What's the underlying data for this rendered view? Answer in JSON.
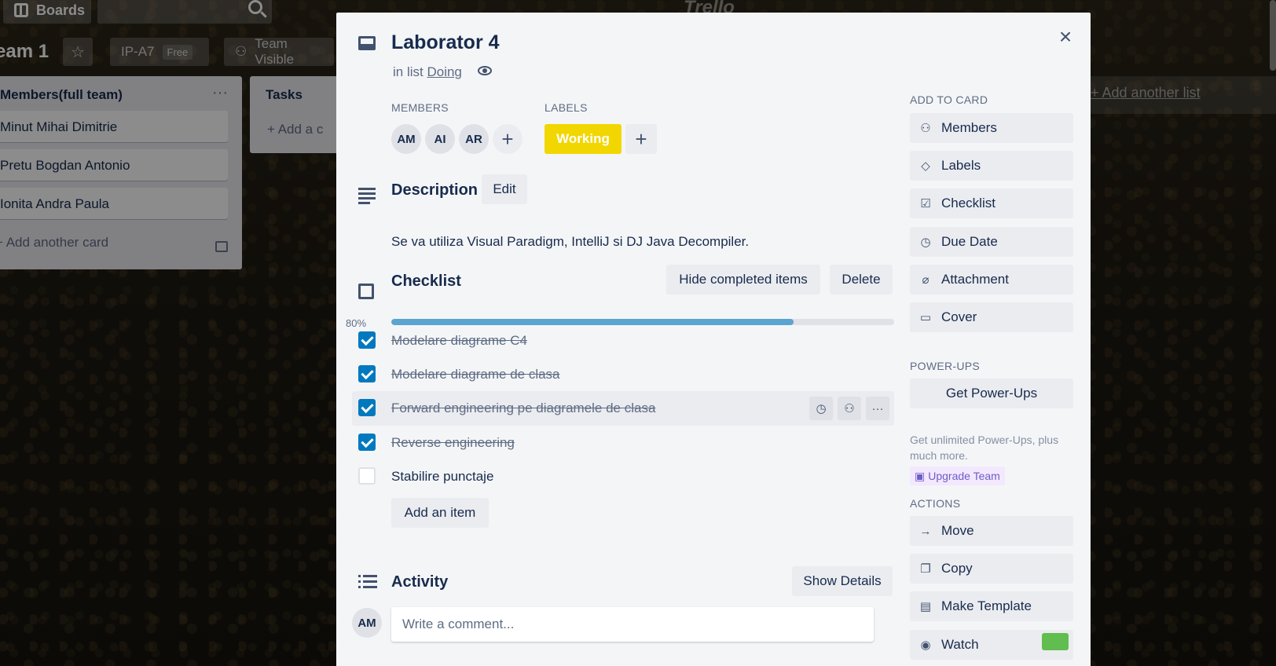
{
  "topbar": {
    "boards_label": "Boards",
    "logo_text": "Trello"
  },
  "board": {
    "title": "eam 1",
    "workspace": "IP-A7",
    "workspace_tag": "Free",
    "visibility": "Team Visible",
    "add_list": "Add another list"
  },
  "lists": {
    "members": {
      "title": "Members(full team)",
      "menu": "···",
      "cards": [
        "Minut Mihai Dimitrie",
        "Pretu Bogdan Antonio",
        "Ionita Andra Paula"
      ],
      "add_card": "+ Add another card"
    },
    "tasks": {
      "title": "Tasks",
      "add_card": "+ Add a c"
    }
  },
  "modal": {
    "title": "Laborator 4",
    "in_list_prefix": "in list ",
    "list_name": "Doing",
    "close": "×",
    "members_label": "MEMBERS",
    "members": [
      "AM",
      "AI",
      "AR"
    ],
    "labels_label": "LABELS",
    "label_working": "Working",
    "label_color": "#f2d600",
    "plus": "+",
    "description_title": "Description",
    "edit_label": "Edit",
    "description_text": "Se va utiliza Visual Paradigm, IntelliJ si DJ Java Decompiler.",
    "checklist": {
      "title": "Checklist",
      "hide_label": "Hide completed items",
      "delete_label": "Delete",
      "percent_label": "80%",
      "progress": 0.8,
      "progress_color": "#5ba4cf",
      "items": [
        {
          "text": "Modelare diagrame C4",
          "done": true
        },
        {
          "text": "Modelare diagrame de clasa",
          "done": true
        },
        {
          "text": "Forward engineering pe diagramele de clasa",
          "done": true
        },
        {
          "text": "Reverse engineering",
          "done": true
        },
        {
          "text": "Stabilire punctaje",
          "done": false
        }
      ],
      "add_item": "Add an item"
    },
    "activity": {
      "title": "Activity",
      "show_details": "Show Details",
      "avatar": "AM",
      "comment_placeholder": "Write a comment..."
    },
    "sidebar": {
      "add_to_card": "ADD TO CARD",
      "add_items": [
        {
          "label": "Members",
          "icon": "person-icon"
        },
        {
          "label": "Labels",
          "icon": "tag-icon"
        },
        {
          "label": "Checklist",
          "icon": "checklist-icon"
        },
        {
          "label": "Due Date",
          "icon": "clock-icon"
        },
        {
          "label": "Attachment",
          "icon": "paperclip-icon"
        },
        {
          "label": "Cover",
          "icon": "cover-icon"
        }
      ],
      "power_ups": "POWER-UPS",
      "get_power_ups": "Get Power-Ups",
      "power_note": "Get unlimited Power-Ups, plus much more.",
      "upgrade": "Upgrade Team",
      "actions": "ACTIONS",
      "action_items": [
        {
          "label": "Move",
          "icon": "arrow-right-icon"
        },
        {
          "label": "Copy",
          "icon": "copy-icon"
        },
        {
          "label": "Make Template",
          "icon": "template-icon"
        },
        {
          "label": "Watch",
          "icon": "eye-icon"
        }
      ]
    }
  }
}
